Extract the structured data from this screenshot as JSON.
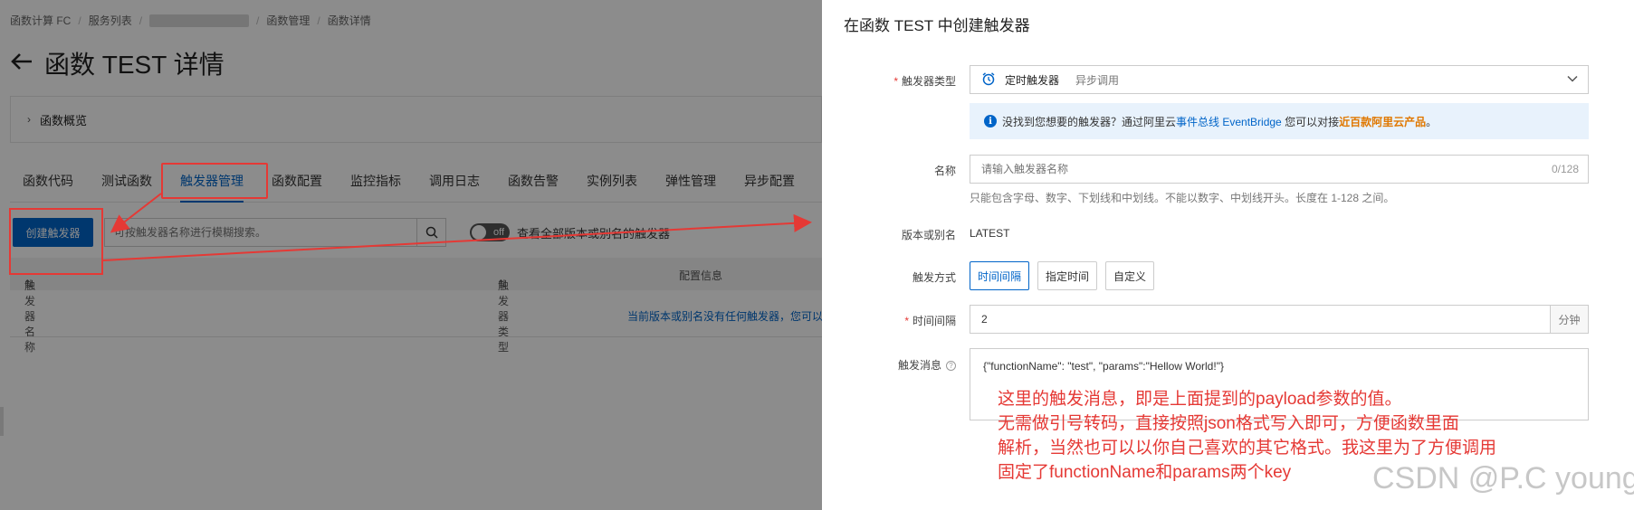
{
  "breadcrumb": {
    "items": [
      "函数计算 FC",
      "服务列表",
      "函数管理",
      "函数详情"
    ]
  },
  "page": {
    "back_icon": "back-arrow-icon",
    "title": "函数 TEST 详情"
  },
  "overview": {
    "label": "函数概览"
  },
  "tabs": [
    "函数代码",
    "测试函数",
    "触发器管理",
    "函数配置",
    "监控指标",
    "调用日志",
    "函数告警",
    "实例列表",
    "弹性管理",
    "异步配置"
  ],
  "toolbar": {
    "create_label": "创建触发器",
    "search_placeholder": "可按触发器名称进行模糊搜索。",
    "toggle_text": "off",
    "toggle_label": "查看全部版本或别名的触发器"
  },
  "table": {
    "columns": [
      "触发器名称",
      "触发器类型",
      "配置信息"
    ],
    "sort_glyph": "⇅",
    "empty_text": "当前版本或别名没有任何触发器，您可以"
  },
  "drawer": {
    "title": "在函数 TEST 中创建触发器",
    "trigger_type": {
      "label": "触发器类型",
      "value": "定时触发器",
      "sub": "异步调用"
    },
    "info": {
      "part1": "没找到您想要的触发器？通过阿里云",
      "link": "事件总线 EventBridge",
      "part2": " 您可以对接",
      "highlight": "近百款阿里云产品",
      "end": "。"
    },
    "name": {
      "label": "名称",
      "placeholder": "请输入触发器名称",
      "count": "0/128",
      "help": "只能包含字母、数字、下划线和中划线。不能以数字、中划线开头。长度在 1-128 之间。"
    },
    "version": {
      "label": "版本或别名",
      "value": "LATEST"
    },
    "mode": {
      "label": "触发方式",
      "options": [
        "时间间隔",
        "指定时间",
        "自定义"
      ],
      "selected": "时间间隔"
    },
    "interval": {
      "label": "时间间隔",
      "value": "2",
      "unit": "分钟"
    },
    "message": {
      "label": "触发消息",
      "value": "{\"functionName\": \"test\", \"params\":\"Hellow World!\"}"
    }
  },
  "annotation": [
    "这里的触发消息，即是上面提到的payload参数的值。",
    "无需做引号转码，直接按照json格式写入即可，方便函数里面",
    "解析，当然也可以以你自己喜欢的其它格式。我这里为了方便调用",
    "固定了functionName和params两个key"
  ],
  "watermark": "CSDN @P.C young",
  "colors": {
    "primary": "#0064c8",
    "annotation_red": "#e53935",
    "highlight_orange": "#e07800"
  }
}
